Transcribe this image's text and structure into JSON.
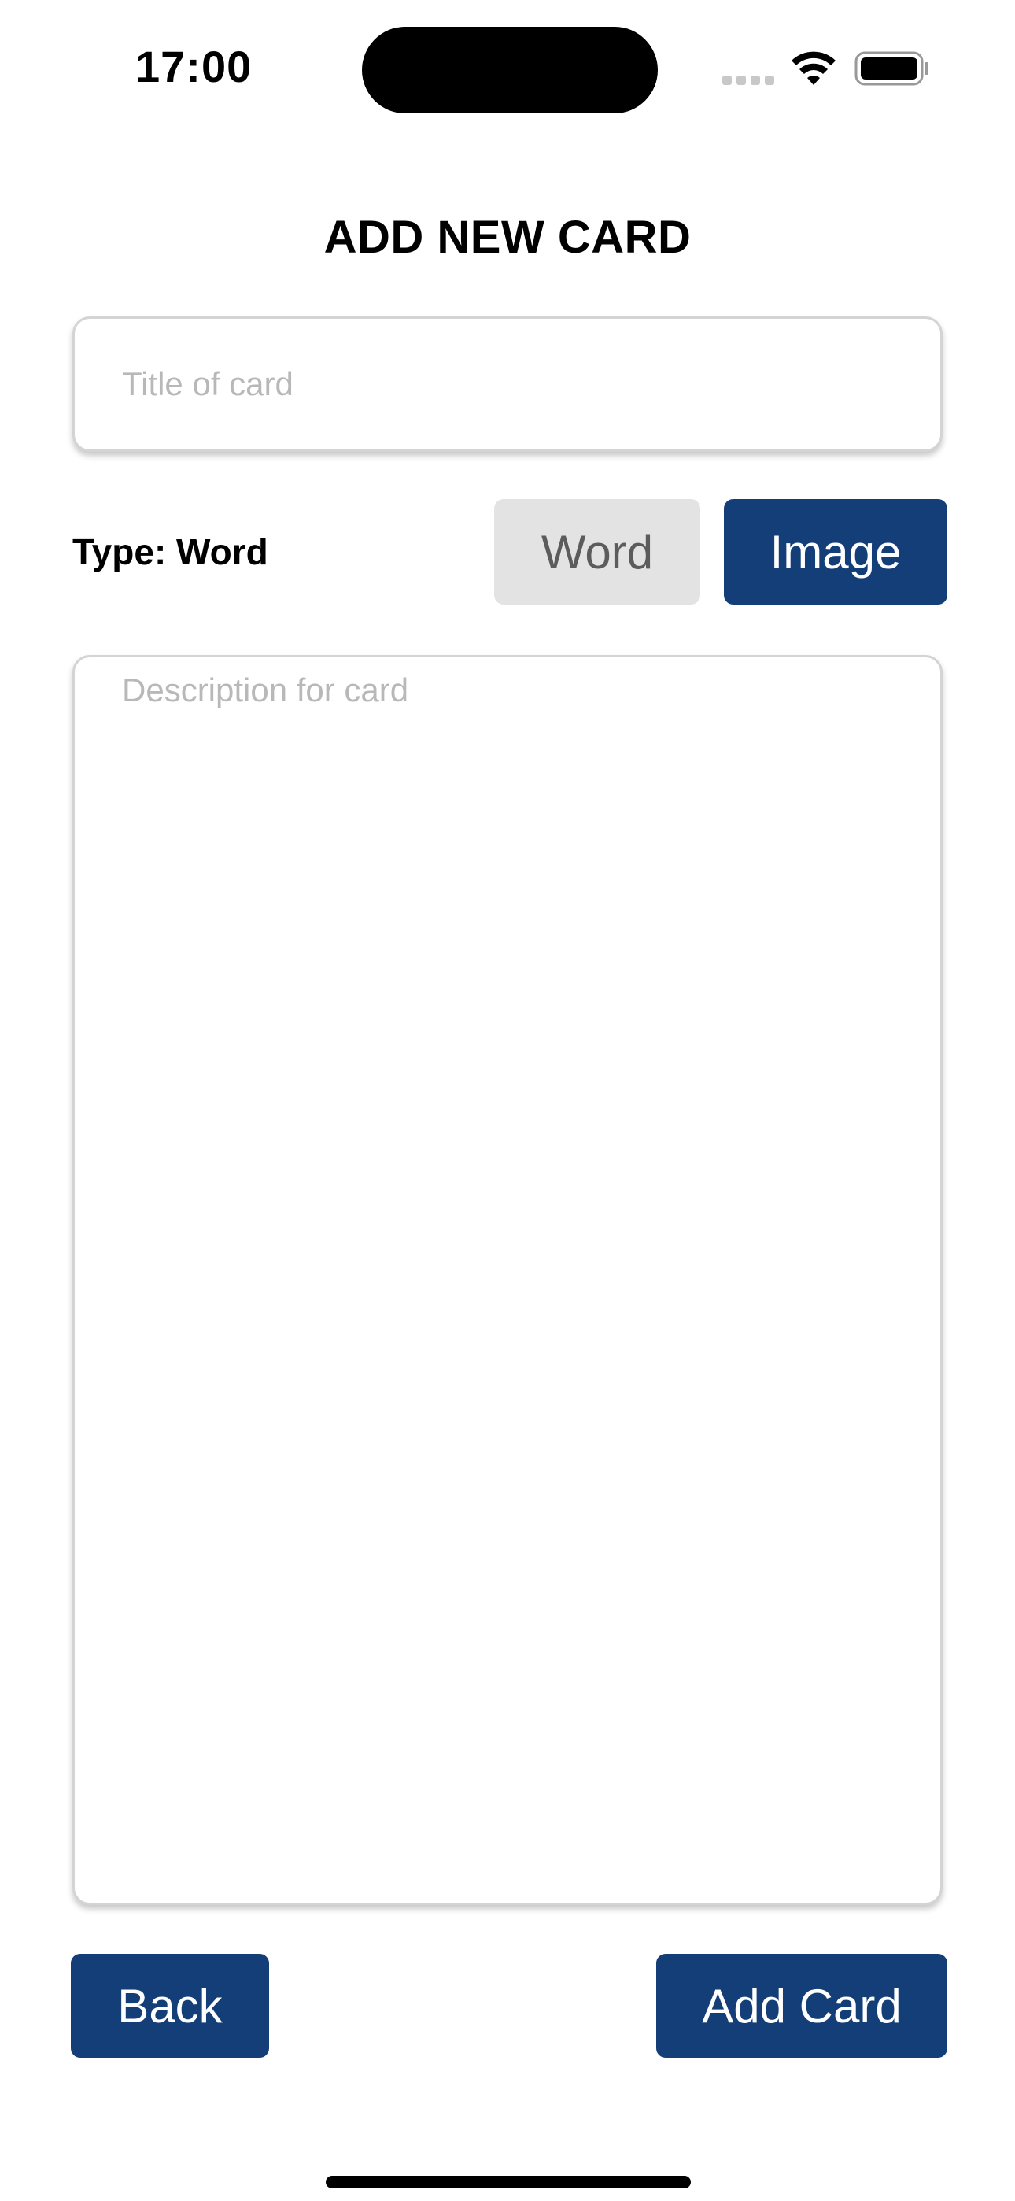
{
  "status_bar": {
    "time": "17:00",
    "signal_icon": "cellular-signal-icon",
    "wifi_icon": "wifi-icon",
    "battery_icon": "battery-icon"
  },
  "page": {
    "title": "ADD NEW CARD"
  },
  "form": {
    "title_input": {
      "value": "",
      "placeholder": "Title of card"
    },
    "type_label": "Type: Word",
    "type_options": [
      {
        "label": "Word",
        "selected": true
      },
      {
        "label": "Image",
        "selected": false
      }
    ],
    "description_input": {
      "value": "",
      "placeholder": "Description for card"
    }
  },
  "actions": {
    "back_label": "Back",
    "add_label": "Add Card"
  },
  "colors": {
    "primary": "#143e78",
    "selected_option_bg": "#e3e3e3",
    "selected_option_text": "#5c5c5c",
    "placeholder": "#b8b8b8",
    "background": "#ffffff"
  }
}
